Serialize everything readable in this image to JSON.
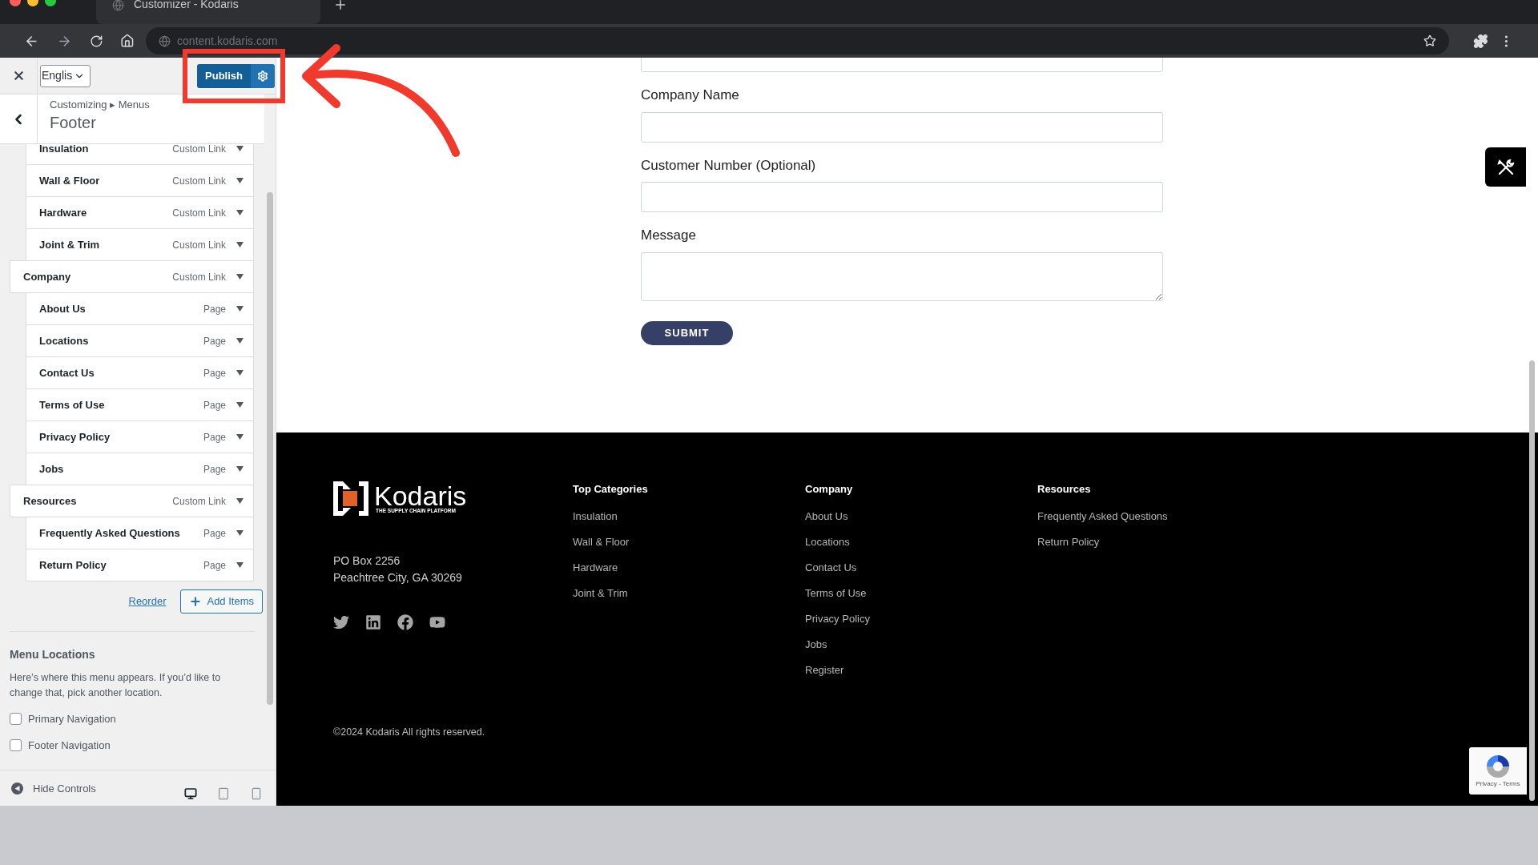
{
  "browser": {
    "tab_title": "Customizer - Kodaris",
    "url": "content.kodaris.com"
  },
  "customizer": {
    "language": "Englis",
    "publish": "Publish",
    "breadcrumb": "Customizing ▸ Menus",
    "title": "Footer",
    "menu_items": [
      {
        "children": [
          {
            "label": "Insulation",
            "type": "Custom Link"
          },
          {
            "label": "Wall & Floor",
            "type": "Custom Link"
          },
          {
            "label": "Hardware",
            "type": "Custom Link"
          },
          {
            "label": "Joint & Trim",
            "type": "Custom Link"
          }
        ]
      },
      {
        "label": "Company",
        "type": "Custom Link",
        "children": [
          {
            "label": "About Us",
            "type": "Page"
          },
          {
            "label": "Locations",
            "type": "Page"
          },
          {
            "label": "Contact Us",
            "type": "Page"
          },
          {
            "label": "Terms of Use",
            "type": "Page"
          },
          {
            "label": "Privacy Policy",
            "type": "Page"
          },
          {
            "label": "Jobs",
            "type": "Page"
          }
        ]
      },
      {
        "label": "Resources",
        "type": "Custom Link",
        "children": [
          {
            "label": "Frequently Asked Questions",
            "type": "Page"
          },
          {
            "label": "Return Policy",
            "type": "Page"
          }
        ]
      }
    ],
    "reorder": "Reorder",
    "add_items": "Add Items",
    "menu_locations": {
      "title": "Menu Locations",
      "description": "Here’s where this menu appears. If you’d like to change that, pick another location.",
      "options": [
        {
          "label": "Primary Navigation",
          "checked": false
        },
        {
          "label": "Footer Navigation",
          "checked": false
        }
      ]
    },
    "hide_controls": "Hide Controls",
    "devices": [
      {
        "kind": "desktop",
        "selected": true
      },
      {
        "kind": "tablet",
        "selected": false
      },
      {
        "kind": "mobile",
        "selected": false
      }
    ]
  },
  "form": {
    "fields": [
      {
        "kind": "input"
      },
      {
        "label": "Company Name",
        "kind": "input"
      },
      {
        "label": "Customer Number (Optional)",
        "kind": "input"
      },
      {
        "label": "Message",
        "kind": "textarea"
      }
    ],
    "submit": "SUBMIT"
  },
  "footer": {
    "logo": {
      "name": "Kodaris",
      "tagline": "THE SUPPLY CHAIN PLATFORM"
    },
    "address": [
      "PO Box 2256",
      "Peachtree City, GA 30269"
    ],
    "columns": [
      {
        "heading": "Top Categories",
        "links": [
          "Insulation",
          "Wall & Floor",
          "Hardware",
          "Joint & Trim"
        ]
      },
      {
        "heading": "Company",
        "links": [
          "About Us",
          "Locations",
          "Contact Us",
          "Terms of Use",
          "Privacy Policy",
          "Jobs",
          "Register"
        ]
      },
      {
        "heading": "Resources",
        "links": [
          "Frequently Asked Questions",
          "Return Policy"
        ]
      }
    ],
    "copyright": "©2024 Kodaris All rights reserved."
  },
  "recaptcha": "Privacy - Terms"
}
